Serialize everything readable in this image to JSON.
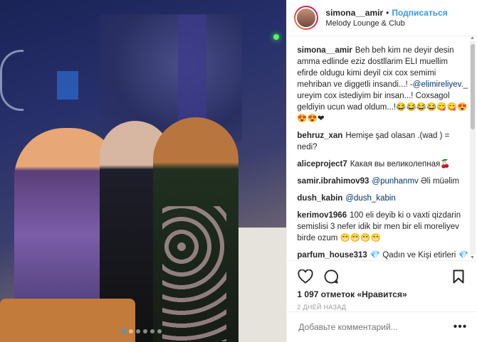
{
  "header": {
    "username": "simona__amir",
    "separator": "•",
    "follow_label": "Подписаться",
    "location": "Melody Lounge & Club"
  },
  "comments": [
    {
      "user": "simona__amir",
      "parts": [
        "Beh beh kim ne deyir desin amma edlinde eziz dostllarim ELI muellim efirde oldugu kimi deyil cix cox semimi mehriban ve diggetli insandi...! -",
        "@elimireliyev._",
        " ureyim cox istediyim bir insan...! Coxsagol geldiyin ucun wad oldum...!😂😂😂😂😋😋😍😍😍❤"
      ]
    },
    {
      "user": "behruz_xan",
      "parts": [
        "Hemişe şad olasan .(wad ) = nedi?"
      ]
    },
    {
      "user": "aliceproject7",
      "parts": [
        "Какая вы великолепная🍒"
      ]
    },
    {
      "user": "samir.ibrahimov93",
      "parts": [
        "",
        "@punhanmv",
        " Əli müəlim"
      ]
    },
    {
      "user": "dush_kabin",
      "parts": [
        "",
        "@dush_kabin",
        ""
      ]
    },
    {
      "user": "kerimov1966",
      "parts": [
        "100 eli deyib ki o vaxti qizdarin semislisi 3 nefer idik bir men bir eli moreliyev birde ozum 😁😁😁😁"
      ]
    },
    {
      "user": "parfum_house313",
      "parts": [
        "💎 Qadın ve Kişi etirleri 💎"
      ]
    }
  ],
  "icons": {
    "like": "heart-outline",
    "comment": "speech-bubble",
    "save": "bookmark"
  },
  "likes_text": "1 097 отметок «Нравится»",
  "time_text": "2 дней назад",
  "add_comment": {
    "placeholder": "Добавьте комментарий...",
    "more": "•••"
  },
  "carousel": {
    "total_dots": 6,
    "active_index": 0
  },
  "colors": {
    "accent": "#3897f0",
    "text": "#262626",
    "muted": "#999999",
    "mention": "#003569"
  }
}
